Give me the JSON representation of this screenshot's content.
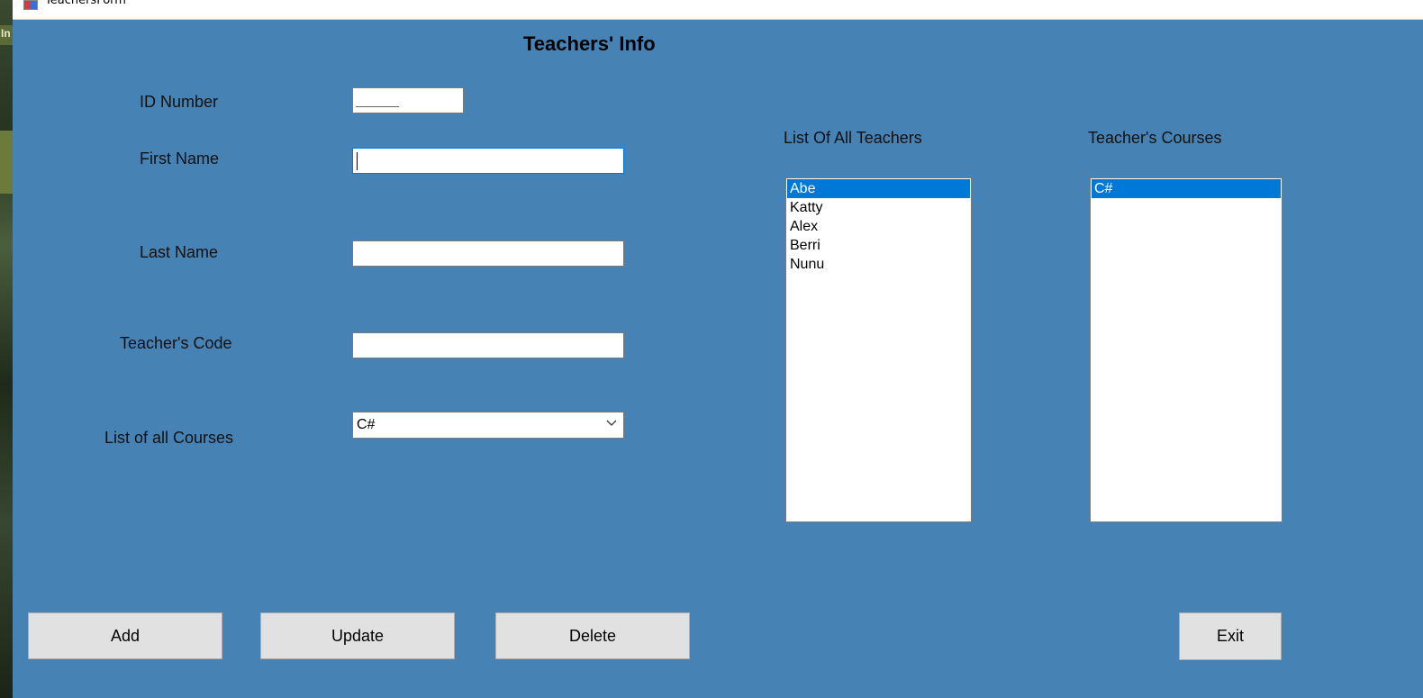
{
  "window": {
    "title": "TeachersForm"
  },
  "desktop": {
    "partial_text": "In"
  },
  "form": {
    "heading": "Teachers' Info",
    "id_label": "ID Number",
    "id_value": "_____",
    "first_name_label": "First Name",
    "first_name_value": "",
    "last_name_label": "Last Name",
    "last_name_value": "",
    "teacher_code_label": "Teacher's Code",
    "teacher_code_value": "",
    "courses_label": "List of all Courses",
    "courses_selected": "C#"
  },
  "teachers_list": {
    "label": "List Of All Teachers",
    "items": [
      "Abe",
      "Katty",
      "Alex",
      "Berri",
      "Nunu"
    ],
    "selected_index": 0
  },
  "teacher_courses": {
    "label": "Teacher's Courses",
    "items": [
      "C#"
    ],
    "selected_index": 0
  },
  "buttons": {
    "add": "Add",
    "update": "Update",
    "delete": "Delete",
    "exit": "Exit"
  },
  "colors": {
    "form_background": "#4682b4",
    "selection": "#0078d7",
    "button_face": "#e1e1e1"
  }
}
